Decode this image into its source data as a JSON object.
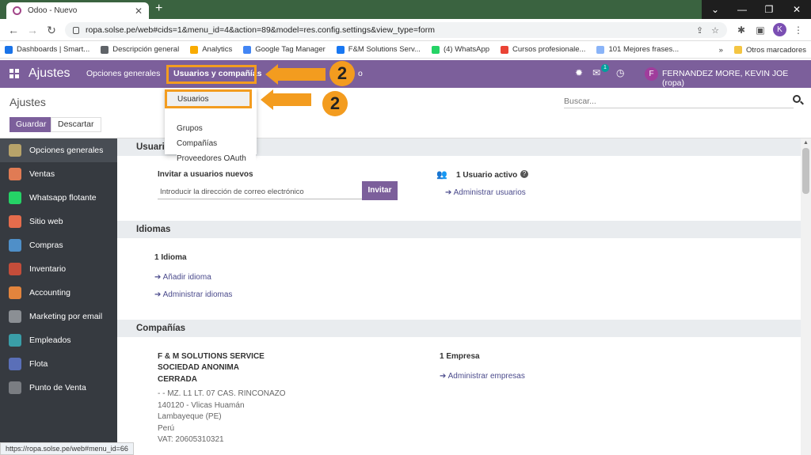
{
  "browser": {
    "tab_title": "Odoo - Nuevo",
    "url": "ropa.solse.pe/web#cids=1&menu_id=4&action=89&model=res.config.settings&view_type=form",
    "profile_initial": "K",
    "status_url": "https://ropa.solse.pe/web#menu_id=66"
  },
  "bookmarks": [
    {
      "label": "Dashboards | Smart...",
      "color": "#1a73e8"
    },
    {
      "label": "Descripción general",
      "color": "#5f6368"
    },
    {
      "label": "Analytics",
      "color": "#f9ab00"
    },
    {
      "label": "Google Tag Manager",
      "color": "#4285f4"
    },
    {
      "label": "F&M Solutions Serv...",
      "color": "#1877f2"
    },
    {
      "label": "(4) WhatsApp",
      "color": "#25d366"
    },
    {
      "label": "Cursos profesionale...",
      "color": "#ea4335"
    },
    {
      "label": "101 Mejores frases...",
      "color": "#8ab4f8"
    }
  ],
  "bookmarks_other": "Otros marcadores",
  "navbar": {
    "brand": "Ajustes",
    "items": [
      "Opciones generales",
      "Usuarios y compañías",
      "o"
    ],
    "badge": "1",
    "user": "FERNANDEZ MORE, KEVIN JOE (ropa)",
    "user_initial": "F"
  },
  "dropdown": [
    "Usuarios",
    "Grupos",
    "Compañías",
    "Proveedores OAuth"
  ],
  "control": {
    "title": "Ajustes",
    "save": "Guardar",
    "discard": "Descartar",
    "search_placeholder": "Buscar..."
  },
  "sidebar": [
    {
      "label": "Opciones generales",
      "color": "#b7a36a"
    },
    {
      "label": "Ventas",
      "color": "#e07b54"
    },
    {
      "label": "Whatsapp flotante",
      "color": "#25d366"
    },
    {
      "label": "Sitio web",
      "color": "#e56c4c"
    },
    {
      "label": "Compras",
      "color": "#4f8fc8"
    },
    {
      "label": "Inventario",
      "color": "#c44d3a"
    },
    {
      "label": "Accounting",
      "color": "#e2843d"
    },
    {
      "label": "Marketing por email",
      "color": "#8b8f94"
    },
    {
      "label": "Empleados",
      "color": "#3a9ea8"
    },
    {
      "label": "Flota",
      "color": "#5a6fb8"
    },
    {
      "label": "Punto de Venta",
      "color": "#7a7d82"
    }
  ],
  "sections": {
    "users": {
      "title": "Usuarios",
      "invite_label": "Invitar a usuarios nuevos",
      "invite_placeholder": "Introducir la dirección de correo electrónico",
      "invite_button": "Invitar",
      "active_users": "1 Usuario activo",
      "manage_users": "Administrar usuarios"
    },
    "languages": {
      "title": "Idiomas",
      "count": "1 Idioma",
      "add": "Añadir idioma",
      "manage": "Administrar idiomas"
    },
    "companies": {
      "title": "Compañías",
      "name_lines": [
        "F & M SOLUTIONS SERVICE",
        "SOCIEDAD ANONIMA",
        "CERRADA"
      ],
      "address_lines": [
        "- - MZ. L1 LT. 07 CAS. RINCONAZO",
        "140120 - Vlicas Huamán",
        "Lambayeque (PE)",
        "Perú",
        "VAT: 20605310321"
      ],
      "count": "1 Empresa",
      "manage": "Administrar empresas"
    }
  },
  "annotations": {
    "step": "2",
    "color": "#f39c1f"
  }
}
